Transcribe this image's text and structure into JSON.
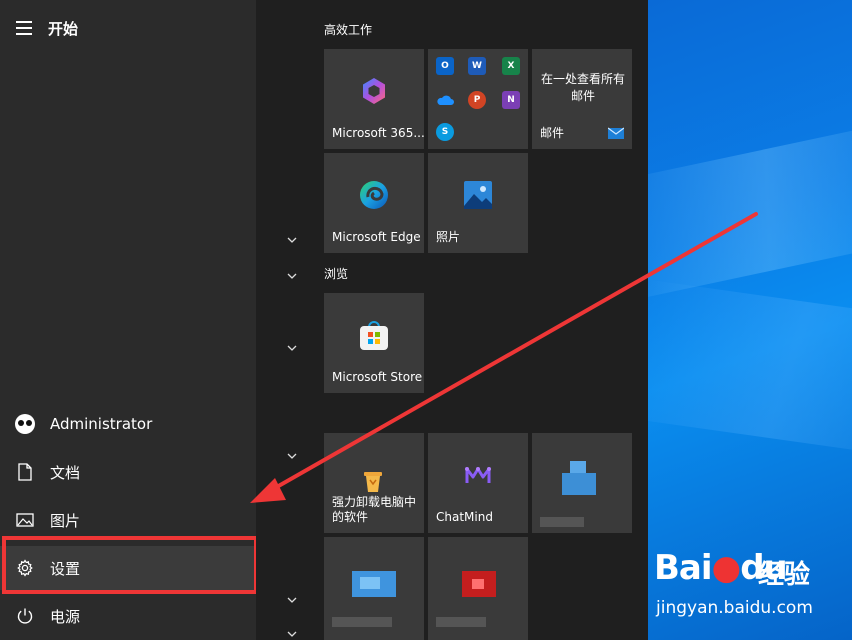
{
  "start_menu": {
    "title": "开始",
    "user": "Administrator",
    "items": [
      {
        "label": "文档"
      },
      {
        "label": "图片"
      },
      {
        "label": "设置"
      },
      {
        "label": "电源"
      }
    ]
  },
  "groups": [
    {
      "label": "高效工作"
    },
    {
      "label": "浏览"
    }
  ],
  "tiles": {
    "m365": "Microsoft 365...",
    "mail_text": "在一处查看所有邮件",
    "mail": "邮件",
    "edge": "Microsoft Edge",
    "photos": "照片",
    "store": "Microsoft Store",
    "uninstaller": "强力卸载电脑中的软件",
    "chatmind": "ChatMind"
  },
  "office_icons": [
    "O",
    "W",
    "X",
    "",
    "P",
    "N",
    "S"
  ],
  "watermark": {
    "logo_left": "Bai",
    "logo_right": "du",
    "cn": "经验",
    "url": "jingyan.baidu.com"
  },
  "colors": {
    "accent_red": "#ee3636",
    "desktop_blue": "#0b7de6"
  }
}
